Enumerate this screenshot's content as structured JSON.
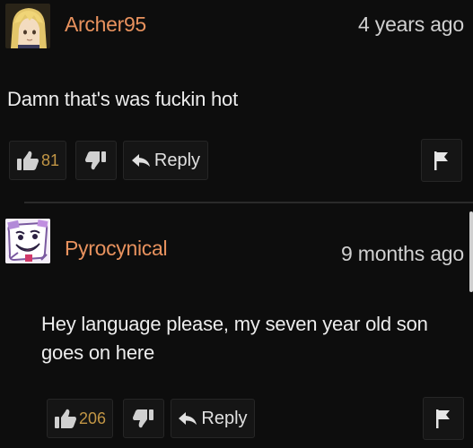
{
  "comments": [
    {
      "username": "Archer95",
      "username_color": "#e8925e",
      "timestamp": "4 years ago",
      "body": "Damn that's was fuckin hot",
      "likes": "81",
      "reply_label": "Reply",
      "avatar_icon": "anime-avatar-icon"
    },
    {
      "username": "Pyrocynical",
      "username_color": "#e8925e",
      "timestamp": "9 months ago",
      "body": "Hey language please, my seven year old son goes on here",
      "likes": "206",
      "reply_label": "Reply",
      "avatar_icon": "pyrocynical-avatar-icon"
    }
  ],
  "colors": {
    "background": "#0d0d0d",
    "like_count": "#c29645",
    "username": "#e8925e"
  }
}
